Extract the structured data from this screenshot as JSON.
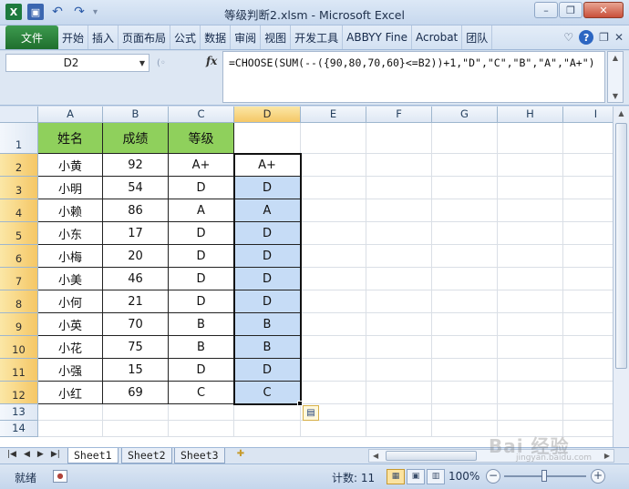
{
  "window": {
    "title": "等级判断2.xlsm  -  Microsoft Excel",
    "minimize": "–",
    "restore": "❐",
    "close": "✕"
  },
  "qat": {
    "app_icon": "X",
    "save_icon": "save-icon",
    "undo_icon": "↶",
    "redo_icon": "↷",
    "dropdown": "▾"
  },
  "ribbon": {
    "file_tab": "文件",
    "tabs": [
      "开始",
      "插入",
      "页面布局",
      "公式",
      "数据",
      "审阅",
      "视图",
      "开发工具",
      "ABBYY Fine",
      "Acrobat",
      "团队"
    ],
    "right_icons": {
      "collapse": "♡",
      "help": "?",
      "window_restore": "❐",
      "window_close": "✕"
    }
  },
  "formula_bar": {
    "name_box": "D2",
    "fx": "fx",
    "formula": "=CHOOSE(SUM(--({90,80,70,60}<=B2))+1,\"D\",\"C\",\"B\",\"A\",\"A+\")"
  },
  "sheet": {
    "columns": [
      "A",
      "B",
      "C",
      "D",
      "E",
      "F",
      "G",
      "H",
      "I"
    ],
    "selected_column": "D",
    "row_numbers": [
      "1",
      "2",
      "3",
      "4",
      "5",
      "6",
      "7",
      "8",
      "9",
      "10",
      "11",
      "12",
      "13",
      "14"
    ],
    "selected_rows": [
      "2",
      "3",
      "4",
      "5",
      "6",
      "7",
      "8",
      "9",
      "10",
      "11",
      "12"
    ],
    "headers": [
      "姓名",
      "成绩",
      "等级"
    ],
    "rows": [
      [
        "小黄",
        "92",
        "A+",
        "A+"
      ],
      [
        "小明",
        "54",
        "D",
        "D"
      ],
      [
        "小赖",
        "86",
        "A",
        "A"
      ],
      [
        "小东",
        "17",
        "D",
        "D"
      ],
      [
        "小梅",
        "20",
        "D",
        "D"
      ],
      [
        "小美",
        "46",
        "D",
        "D"
      ],
      [
        "小何",
        "21",
        "D",
        "D"
      ],
      [
        "小英",
        "70",
        "B",
        "B"
      ],
      [
        "小花",
        "75",
        "B",
        "B"
      ],
      [
        "小强",
        "15",
        "D",
        "D"
      ],
      [
        "小红",
        "69",
        "C",
        "C"
      ]
    ],
    "header_color": "#8fd05c",
    "selection_color": "#c6dcf6"
  },
  "sheet_tabs": [
    "Sheet1",
    "Sheet2",
    "Sheet3"
  ],
  "active_sheet": "Sheet1",
  "status_bar": {
    "ready": "就绪",
    "count": "计数: 11",
    "zoom": "100%"
  },
  "watermark": {
    "text": "Bai 经验",
    "sub": "jingyan.baidu.com"
  }
}
